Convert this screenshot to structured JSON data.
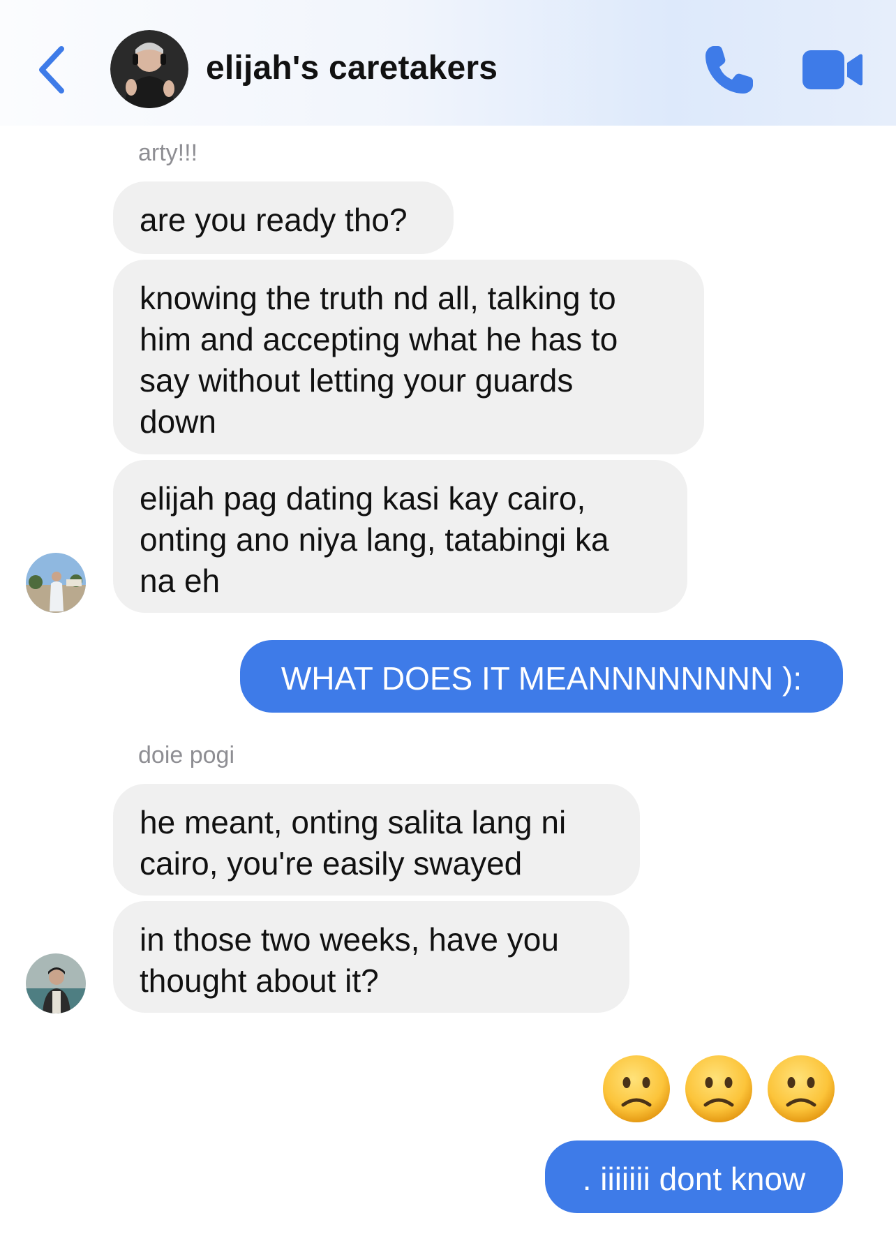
{
  "header": {
    "title": "elijah's caretakers",
    "icons": {
      "back": "chevron-left-icon",
      "call": "phone-icon",
      "video": "video-camera-icon"
    },
    "accent_color": "#3e7be8"
  },
  "messages": {
    "group1": {
      "sender": "arty!!!",
      "bubble1": "are you ready tho?",
      "bubble2": "knowing the truth nd all, talking to\nhim and accepting what he has to\nsay without letting your guards\ndown",
      "bubble3": "elijah pag dating kasi kay cairo,\nonting ano niya lang, tatabingi ka\nna eh"
    },
    "outgoing1": "WHAT DOES IT MEANNNNNNNN ):",
    "group2": {
      "sender": "doie pogi",
      "bubble1": "he meant, onting salita lang ni\ncairo, you're easily swayed",
      "bubble2": "in those two weeks, have you\nthought about it?"
    },
    "reaction_emojis": [
      "slightly-frowning-face",
      "slightly-frowning-face",
      "slightly-frowning-face"
    ],
    "outgoing2": ". iiiiiii dont know"
  }
}
